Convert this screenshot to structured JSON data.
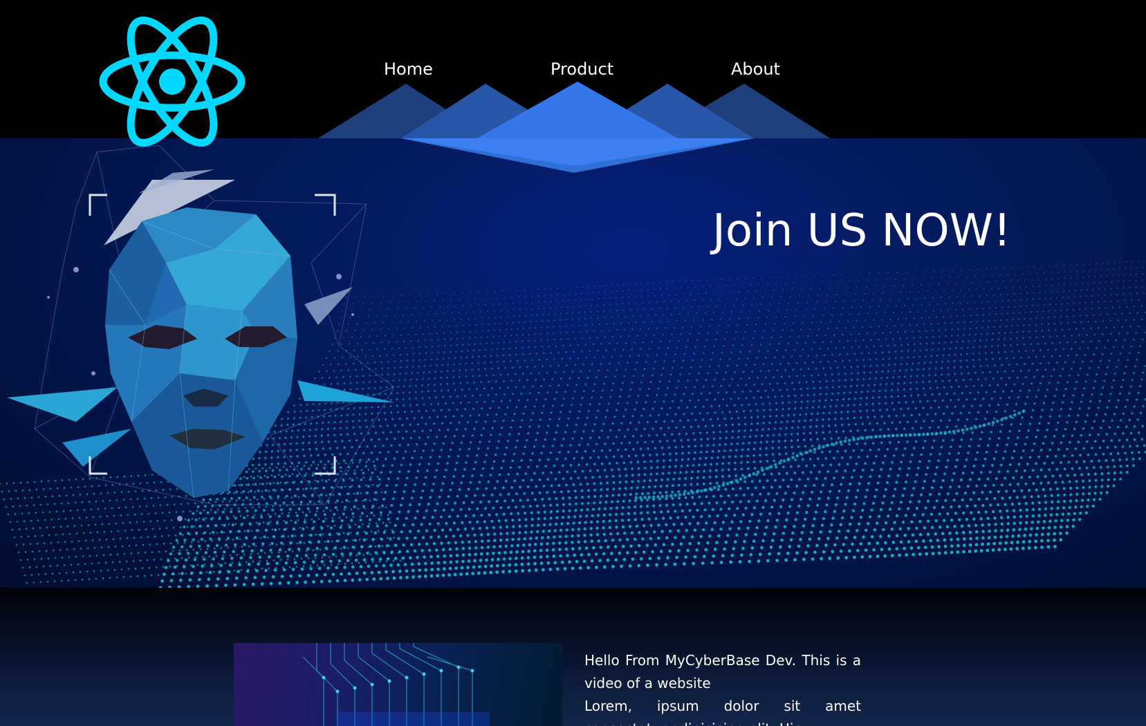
{
  "nav": {
    "home": "Home",
    "product": "Product",
    "about": "About"
  },
  "hero": {
    "title": "Join US NOW!"
  },
  "intro": {
    "line1": "Hello From MyCyberBase Dev. This is a video of a website",
    "line2": "Lorem, ipsum dolor sit amet consectetur adipisicing elit. Hic"
  },
  "colors": {
    "logo": "#00d8ff",
    "mountain_light": "#3b82f6",
    "mountain_dark": "#1e3a8a",
    "hero_bg": "#041a5e",
    "wave_dots": "#1fc6d6"
  },
  "icons": {
    "logo": "react-atom-icon"
  }
}
